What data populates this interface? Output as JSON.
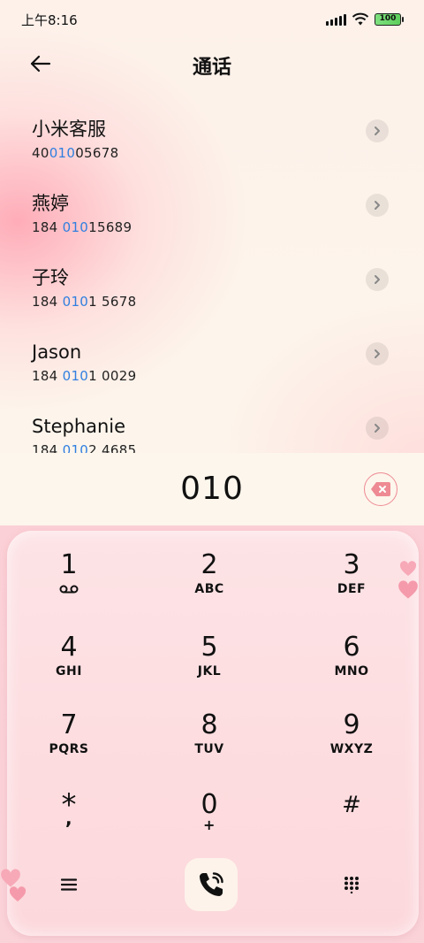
{
  "status_bar": {
    "time": "上午8:16",
    "battery": "100"
  },
  "header": {
    "title": "通话"
  },
  "contacts": [
    {
      "name": "小米客服",
      "number_pre": "40",
      "number_hl": "010",
      "number_post": "05678"
    },
    {
      "name": "燕婷",
      "number_pre": "184 ",
      "number_hl": "010",
      "number_post": "15689"
    },
    {
      "name": "子玲",
      "number_pre": "184 ",
      "number_hl": "010",
      "number_post": "1 5678"
    },
    {
      "name": "Jason",
      "number_pre": "184 ",
      "number_hl": "010",
      "number_post": "1 0029"
    },
    {
      "name": "Stephanie",
      "number_pre": "184 ",
      "number_hl": "010",
      "number_post": "2 4685"
    }
  ],
  "dial_input": {
    "value": "010"
  },
  "keys": [
    {
      "digit": "1",
      "letters": ""
    },
    {
      "digit": "2",
      "letters": "ABC"
    },
    {
      "digit": "3",
      "letters": "DEF"
    },
    {
      "digit": "4",
      "letters": "GHI"
    },
    {
      "digit": "5",
      "letters": "JKL"
    },
    {
      "digit": "6",
      "letters": "MNO"
    },
    {
      "digit": "7",
      "letters": "PQRS"
    },
    {
      "digit": "8",
      "letters": "TUV"
    },
    {
      "digit": "9",
      "letters": "WXYZ"
    },
    {
      "digit": "*",
      "letters": ","
    },
    {
      "digit": "0",
      "letters": "+"
    },
    {
      "digit": "#",
      "letters": ""
    }
  ],
  "colors": {
    "highlight": "#2f7fe0",
    "accent_pink": "#ee8a93",
    "keypad_bg": "#fde3e6"
  },
  "icons": {
    "back": "arrow-left-icon",
    "chevron": "chevron-right-icon",
    "delete": "backspace-icon",
    "voicemail": "voicemail-icon",
    "menu": "menu-icon",
    "call": "phone-call-icon",
    "dialpad": "dialpad-icon"
  }
}
